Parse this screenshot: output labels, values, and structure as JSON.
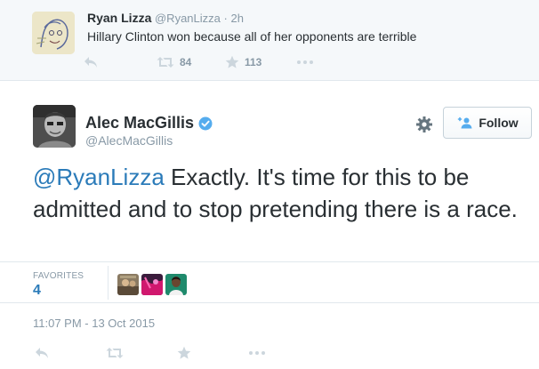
{
  "parent_tweet": {
    "name": "Ryan Lizza",
    "handle": "@RyanLizza",
    "separator": "·",
    "time": "2h",
    "text": "Hillary Clinton won because all of her opponents are terrible",
    "retweet_count": "84",
    "favorite_count": "113",
    "icons": [
      "reply-icon",
      "retweet-icon",
      "favorite-icon",
      "more-icon"
    ]
  },
  "tweet": {
    "author_name": "Alec MacGillis",
    "author_handle": "@AlecMacGillis",
    "verified": true,
    "follow_label": "Follow",
    "mention": "@RyanLizza",
    "text": " Exactly. It's time for this to be admitted and to stop pretending there is a race.",
    "favorites_label": "FAVORITES",
    "favorites_count": "4",
    "timestamp": "11:07 PM - 13 Oct 2015",
    "favoriter_count_shown": 3
  },
  "colors": {
    "link": "#2b7bb9",
    "verified": "#55acee",
    "muted": "#8899a6",
    "text": "#292f33",
    "parent_bg": "#f5f8fa",
    "border": "#e1e8ed"
  }
}
